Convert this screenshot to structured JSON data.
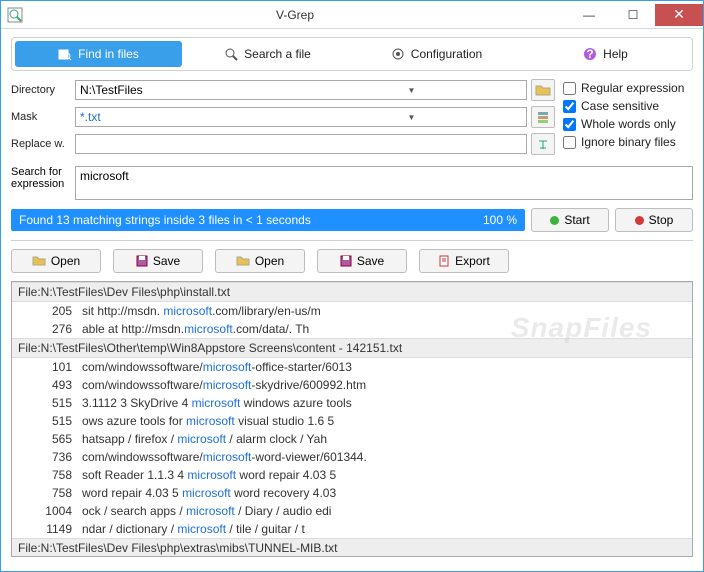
{
  "app": {
    "title": "V-Grep"
  },
  "toolbar": {
    "find": "Find in files",
    "search": "Search a file",
    "config": "Configuration",
    "help": "Help"
  },
  "labels": {
    "directory": "Directory",
    "mask": "Mask",
    "replace": "Replace w.",
    "search_for": "Search for expression"
  },
  "fields": {
    "directory": "N:\\TestFiles",
    "mask": "*.txt",
    "replace": "",
    "search_expr": "microsoft"
  },
  "options": {
    "regex": {
      "label": "Regular expression",
      "checked": false
    },
    "case": {
      "label": "Case sensitive",
      "checked": true
    },
    "whole": {
      "label": "Whole words only",
      "checked": true
    },
    "binary": {
      "label": "Ignore binary files",
      "checked": false
    }
  },
  "status": {
    "text": "Found 13 matching strings inside 3 files in < 1 seconds",
    "pct": "100 %"
  },
  "buttons": {
    "start": "Start",
    "stop": "Stop",
    "open": "Open",
    "save": "Save",
    "export": "Export"
  },
  "watermark": "SnapFiles",
  "results": [
    {
      "type": "file",
      "path": "File:N:\\TestFiles\\Dev Files\\php\\install.txt"
    },
    {
      "type": "line",
      "ln": "205",
      "pre": "sit  http://msdn. ",
      "hl": "microsoft",
      "post": ".com/library/en-us/m"
    },
    {
      "type": "line",
      "ln": "276",
      "pre": "able at http://msdn.",
      "hl": "microsoft",
      "post": ".com/data/.   Th"
    },
    {
      "type": "file",
      "path": "File:N:\\TestFiles\\Other\\temp\\Win8Appstore Screens\\content - 142151.txt"
    },
    {
      "type": "line",
      "ln": "101",
      "pre": "com/windowssoftware/",
      "hl": "microsoft",
      "post": "-office-starter/6013"
    },
    {
      "type": "line",
      "ln": "493",
      "pre": "com/windowssoftware/",
      "hl": "microsoft",
      "post": "-skydrive/600992.htm"
    },
    {
      "type": "line",
      "ln": "515",
      "pre": "3.1112 3 SkyDrive 4 ",
      "hl": "microsoft",
      "post": " windows azure tools"
    },
    {
      "type": "line",
      "ln": "515",
      "pre": "ows azure tools for ",
      "hl": "microsoft",
      "post": " visual studio 1.6 5"
    },
    {
      "type": "line",
      "ln": "565",
      "pre": "hatsapp / firefox / ",
      "hl": "microsoft",
      "post": " / alarm clock / Yah"
    },
    {
      "type": "line",
      "ln": "736",
      "pre": "com/windowssoftware/",
      "hl": "microsoft",
      "post": "-word-viewer/601344."
    },
    {
      "type": "line",
      "ln": "758",
      "pre": "soft Reader 1.1.3 4 ",
      "hl": "microsoft",
      "post": " word repair 4.03 5"
    },
    {
      "type": "line",
      "ln": "758",
      "pre": " word repair 4.03 5 ",
      "hl": "microsoft",
      "post": " word recovery 4.03"
    },
    {
      "type": "line",
      "ln": "1004",
      "pre": "ock / search apps / ",
      "hl": "microsoft",
      "post": " / Diary / audio edi"
    },
    {
      "type": "line",
      "ln": "1149",
      "pre": "ndar / dictionary / ",
      "hl": "microsoft",
      "post": " / tile / guitar / t"
    },
    {
      "type": "file",
      "path": "File:N:\\TestFiles\\Dev Files\\php\\extras\\mibs\\TUNNEL-MIB.txt"
    }
  ]
}
